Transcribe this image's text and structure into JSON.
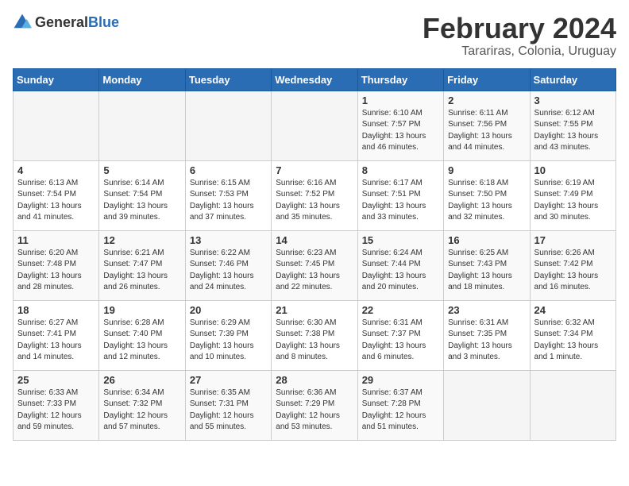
{
  "logo": {
    "general": "General",
    "blue": "Blue"
  },
  "title": "February 2024",
  "subtitle": "Tarariras, Colonia, Uruguay",
  "headers": [
    "Sunday",
    "Monday",
    "Tuesday",
    "Wednesday",
    "Thursday",
    "Friday",
    "Saturday"
  ],
  "weeks": [
    [
      {
        "day": "",
        "sunrise": "",
        "sunset": "",
        "daylight": "",
        "empty": true
      },
      {
        "day": "",
        "sunrise": "",
        "sunset": "",
        "daylight": "",
        "empty": true
      },
      {
        "day": "",
        "sunrise": "",
        "sunset": "",
        "daylight": "",
        "empty": true
      },
      {
        "day": "",
        "sunrise": "",
        "sunset": "",
        "daylight": "",
        "empty": true
      },
      {
        "day": "1",
        "sunrise": "Sunrise: 6:10 AM",
        "sunset": "Sunset: 7:57 PM",
        "daylight": "Daylight: 13 hours and 46 minutes."
      },
      {
        "day": "2",
        "sunrise": "Sunrise: 6:11 AM",
        "sunset": "Sunset: 7:56 PM",
        "daylight": "Daylight: 13 hours and 44 minutes."
      },
      {
        "day": "3",
        "sunrise": "Sunrise: 6:12 AM",
        "sunset": "Sunset: 7:55 PM",
        "daylight": "Daylight: 13 hours and 43 minutes."
      }
    ],
    [
      {
        "day": "4",
        "sunrise": "Sunrise: 6:13 AM",
        "sunset": "Sunset: 7:54 PM",
        "daylight": "Daylight: 13 hours and 41 minutes."
      },
      {
        "day": "5",
        "sunrise": "Sunrise: 6:14 AM",
        "sunset": "Sunset: 7:54 PM",
        "daylight": "Daylight: 13 hours and 39 minutes."
      },
      {
        "day": "6",
        "sunrise": "Sunrise: 6:15 AM",
        "sunset": "Sunset: 7:53 PM",
        "daylight": "Daylight: 13 hours and 37 minutes."
      },
      {
        "day": "7",
        "sunrise": "Sunrise: 6:16 AM",
        "sunset": "Sunset: 7:52 PM",
        "daylight": "Daylight: 13 hours and 35 minutes."
      },
      {
        "day": "8",
        "sunrise": "Sunrise: 6:17 AM",
        "sunset": "Sunset: 7:51 PM",
        "daylight": "Daylight: 13 hours and 33 minutes."
      },
      {
        "day": "9",
        "sunrise": "Sunrise: 6:18 AM",
        "sunset": "Sunset: 7:50 PM",
        "daylight": "Daylight: 13 hours and 32 minutes."
      },
      {
        "day": "10",
        "sunrise": "Sunrise: 6:19 AM",
        "sunset": "Sunset: 7:49 PM",
        "daylight": "Daylight: 13 hours and 30 minutes."
      }
    ],
    [
      {
        "day": "11",
        "sunrise": "Sunrise: 6:20 AM",
        "sunset": "Sunset: 7:48 PM",
        "daylight": "Daylight: 13 hours and 28 minutes."
      },
      {
        "day": "12",
        "sunrise": "Sunrise: 6:21 AM",
        "sunset": "Sunset: 7:47 PM",
        "daylight": "Daylight: 13 hours and 26 minutes."
      },
      {
        "day": "13",
        "sunrise": "Sunrise: 6:22 AM",
        "sunset": "Sunset: 7:46 PM",
        "daylight": "Daylight: 13 hours and 24 minutes."
      },
      {
        "day": "14",
        "sunrise": "Sunrise: 6:23 AM",
        "sunset": "Sunset: 7:45 PM",
        "daylight": "Daylight: 13 hours and 22 minutes."
      },
      {
        "day": "15",
        "sunrise": "Sunrise: 6:24 AM",
        "sunset": "Sunset: 7:44 PM",
        "daylight": "Daylight: 13 hours and 20 minutes."
      },
      {
        "day": "16",
        "sunrise": "Sunrise: 6:25 AM",
        "sunset": "Sunset: 7:43 PM",
        "daylight": "Daylight: 13 hours and 18 minutes."
      },
      {
        "day": "17",
        "sunrise": "Sunrise: 6:26 AM",
        "sunset": "Sunset: 7:42 PM",
        "daylight": "Daylight: 13 hours and 16 minutes."
      }
    ],
    [
      {
        "day": "18",
        "sunrise": "Sunrise: 6:27 AM",
        "sunset": "Sunset: 7:41 PM",
        "daylight": "Daylight: 13 hours and 14 minutes."
      },
      {
        "day": "19",
        "sunrise": "Sunrise: 6:28 AM",
        "sunset": "Sunset: 7:40 PM",
        "daylight": "Daylight: 13 hours and 12 minutes."
      },
      {
        "day": "20",
        "sunrise": "Sunrise: 6:29 AM",
        "sunset": "Sunset: 7:39 PM",
        "daylight": "Daylight: 13 hours and 10 minutes."
      },
      {
        "day": "21",
        "sunrise": "Sunrise: 6:30 AM",
        "sunset": "Sunset: 7:38 PM",
        "daylight": "Daylight: 13 hours and 8 minutes."
      },
      {
        "day": "22",
        "sunrise": "Sunrise: 6:31 AM",
        "sunset": "Sunset: 7:37 PM",
        "daylight": "Daylight: 13 hours and 6 minutes."
      },
      {
        "day": "23",
        "sunrise": "Sunrise: 6:31 AM",
        "sunset": "Sunset: 7:35 PM",
        "daylight": "Daylight: 13 hours and 3 minutes."
      },
      {
        "day": "24",
        "sunrise": "Sunrise: 6:32 AM",
        "sunset": "Sunset: 7:34 PM",
        "daylight": "Daylight: 13 hours and 1 minute."
      }
    ],
    [
      {
        "day": "25",
        "sunrise": "Sunrise: 6:33 AM",
        "sunset": "Sunset: 7:33 PM",
        "daylight": "Daylight: 12 hours and 59 minutes."
      },
      {
        "day": "26",
        "sunrise": "Sunrise: 6:34 AM",
        "sunset": "Sunset: 7:32 PM",
        "daylight": "Daylight: 12 hours and 57 minutes."
      },
      {
        "day": "27",
        "sunrise": "Sunrise: 6:35 AM",
        "sunset": "Sunset: 7:31 PM",
        "daylight": "Daylight: 12 hours and 55 minutes."
      },
      {
        "day": "28",
        "sunrise": "Sunrise: 6:36 AM",
        "sunset": "Sunset: 7:29 PM",
        "daylight": "Daylight: 12 hours and 53 minutes."
      },
      {
        "day": "29",
        "sunrise": "Sunrise: 6:37 AM",
        "sunset": "Sunset: 7:28 PM",
        "daylight": "Daylight: 12 hours and 51 minutes."
      },
      {
        "day": "",
        "sunrise": "",
        "sunset": "",
        "daylight": "",
        "empty": true
      },
      {
        "day": "",
        "sunrise": "",
        "sunset": "",
        "daylight": "",
        "empty": true
      }
    ]
  ]
}
